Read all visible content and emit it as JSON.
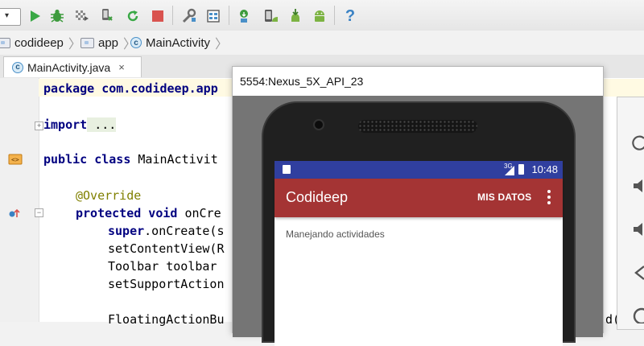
{
  "toolbar": {
    "icons": [
      "run-icon",
      "debug-icon",
      "attach-debugger-icon",
      "apply-changes-icon",
      "rerun-icon",
      "stop-icon",
      "project-structure-icon",
      "sdk-manager-icon",
      "sync-gradle-icon",
      "avd-manager-icon",
      "sdk-download-icon",
      "android-icon",
      "help-icon"
    ]
  },
  "breadcrumb": {
    "items": [
      "codideep",
      "app",
      "MainActivity"
    ]
  },
  "editor_tab": {
    "label": "MainActivity.java",
    "close": "×"
  },
  "code": {
    "line1": "package com.codideep.app",
    "line2_kw": "import",
    "line2_rest": " ...",
    "line3_kw": "public class",
    "line3_rest": " MainActivit",
    "line4": "@Override",
    "line5_kw": "protected void",
    "line5_rest": " onCre",
    "line6_kw": "super",
    "line6_rest": ".onCreate(s",
    "line7": "setContentView(R",
    "line8": "Toolbar toolbar",
    "line9": "setSupportAction",
    "line10": "FloatingActionBu",
    "line10_tail": "d("
  },
  "emulator": {
    "window_title": "5554:Nexus_5X_API_23",
    "status_time": "10:48",
    "status_network": "3G",
    "app_title": "Codideep",
    "action_label": "MIS DATOS",
    "content_text": "Manejando actividades"
  },
  "colors": {
    "status_bar": "#303f9f",
    "app_bar": "#a43434"
  }
}
